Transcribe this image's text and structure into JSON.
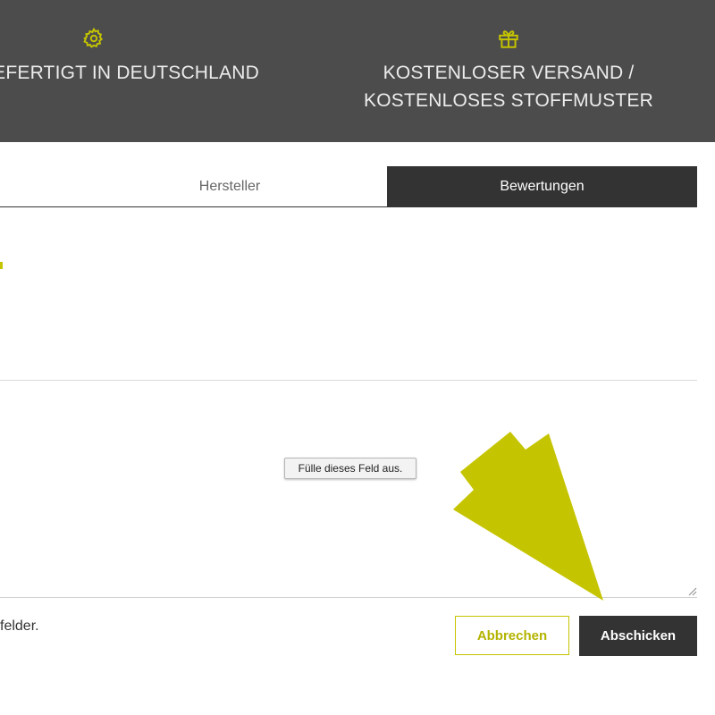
{
  "header": {
    "features": [
      {
        "icon": "gear-icon",
        "label": "GEFERTIGT IN DEUTSCHLAND"
      },
      {
        "icon": "gift-icon",
        "label": "KOSTENLOSER VERSAND / KOSTENLOSES STOFFMUSTER"
      }
    ]
  },
  "tabs": [
    {
      "label": "Hersteller",
      "active": false
    },
    {
      "label": "Bewertungen",
      "active": true
    }
  ],
  "form": {
    "tooltip": "Fülle dieses Feld aus.",
    "required_note": "felder.",
    "cancel_label": "Abbrechen",
    "submit_label": "Abschicken"
  },
  "colors": {
    "accent": "#c5c400",
    "dark": "#333333",
    "header_bg": "#4c4c4c"
  }
}
